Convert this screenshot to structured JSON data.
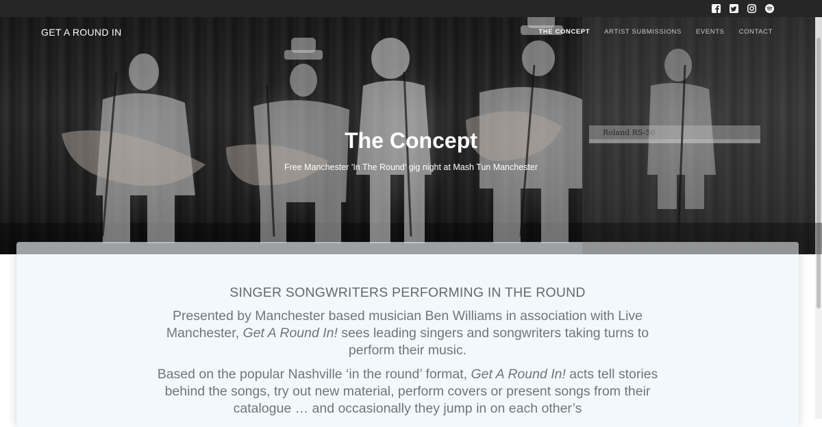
{
  "topbar": {
    "social_icons": [
      "facebook-icon",
      "twitter-icon",
      "instagram-icon",
      "spotify-icon"
    ]
  },
  "nav": {
    "brand": "GET A ROUND IN",
    "items": [
      {
        "label": "THE CONCEPT",
        "active": true
      },
      {
        "label": "ARTIST SUBMISSIONS",
        "active": false
      },
      {
        "label": "EVENTS",
        "active": false
      },
      {
        "label": "CONTACT",
        "active": false
      }
    ]
  },
  "hero": {
    "title": "The Concept",
    "subtitle": "Free Manchester 'In The Round' gig night at Mash Tun Manchester",
    "keyboard_label": "Roland RS-50"
  },
  "content": {
    "heading": "SINGER SONGWRITERS PERFORMING IN THE ROUND",
    "p1_before": "Presented by Manchester based musician Ben Williams in association with Live Manchester, ",
    "p1_em": "Get A Round In!",
    "p1_after": " sees leading singers and songwriters taking turns to perform their music.",
    "p2_before": "Based on the popular Nashville ‘in the round’ format, ",
    "p2_em": "Get A Round In!",
    "p2_after": " acts tell stories behind the songs, try out new material, perform covers or present songs from their catalogue … and occasionally they jump in on each other’s"
  },
  "colors": {
    "topbar": "#262626",
    "card_bg": "#f3f8fc",
    "text_gray": "#6d757d"
  }
}
